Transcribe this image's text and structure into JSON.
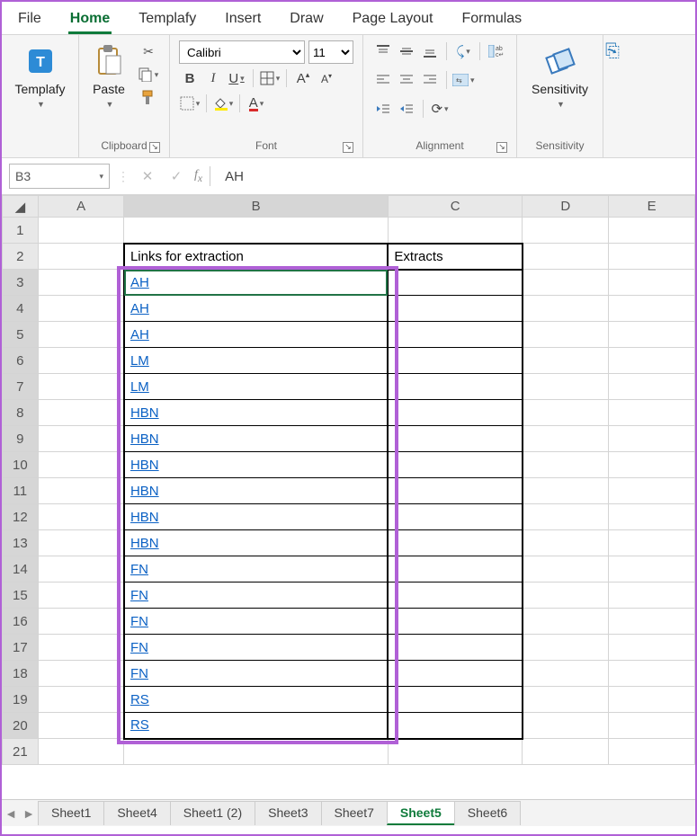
{
  "menu": {
    "file": "File",
    "home": "Home",
    "templafy": "Templafy",
    "insert": "Insert",
    "draw": "Draw",
    "pagelayout": "Page Layout",
    "formulas": "Formulas"
  },
  "ribbon": {
    "templafy": {
      "label": "Templafy"
    },
    "clipboard": {
      "label": "Clipboard",
      "paste": "Paste"
    },
    "font": {
      "label": "Font",
      "name": "Calibri",
      "size": "11"
    },
    "alignment": {
      "label": "Alignment"
    },
    "sensitivity": {
      "label": "Sensitivity",
      "btn": "Sensitivity"
    }
  },
  "namebox": {
    "cell": "B3",
    "value": "AH"
  },
  "columns": [
    "A",
    "B",
    "C",
    "D",
    "E"
  ],
  "headers": {
    "b": "Links for extraction",
    "c": "Extracts"
  },
  "rows": [
    {
      "n": 1
    },
    {
      "n": 2,
      "header": true
    },
    {
      "n": 3,
      "link": "AH",
      "active": true
    },
    {
      "n": 4,
      "link": "AH"
    },
    {
      "n": 5,
      "link": "AH"
    },
    {
      "n": 6,
      "link": "LM"
    },
    {
      "n": 7,
      "link": "LM"
    },
    {
      "n": 8,
      "link": "HBN"
    },
    {
      "n": 9,
      "link": "HBN"
    },
    {
      "n": 10,
      "link": "HBN"
    },
    {
      "n": 11,
      "link": "HBN"
    },
    {
      "n": 12,
      "link": "HBN"
    },
    {
      "n": 13,
      "link": "HBN"
    },
    {
      "n": 14,
      "link": "FN"
    },
    {
      "n": 15,
      "link": "FN"
    },
    {
      "n": 16,
      "link": "FN"
    },
    {
      "n": 17,
      "link": "FN"
    },
    {
      "n": 18,
      "link": "FN"
    },
    {
      "n": 19,
      "link": "RS"
    },
    {
      "n": 20,
      "link": "RS",
      "last": true
    },
    {
      "n": 21
    }
  ],
  "sheets": [
    "Sheet1",
    "Sheet4",
    "Sheet1 (2)",
    "Sheet3",
    "Sheet7",
    "Sheet5",
    "Sheet6"
  ],
  "activeSheet": "Sheet5"
}
